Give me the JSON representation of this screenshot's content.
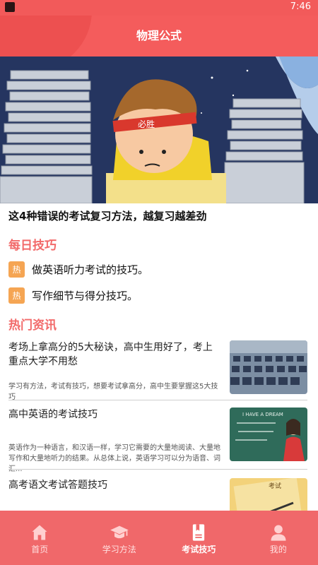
{
  "status_bar": {
    "time": "7:46"
  },
  "header": {
    "title": "物理公式"
  },
  "banner": {
    "caption": "这4种错误的考试复习方法，越复习越差劲",
    "headband_text": "必胜"
  },
  "daily_tips": {
    "title": "每日技巧",
    "items": [
      {
        "badge": "热",
        "text": "做英语听力考试的技巧。"
      },
      {
        "badge": "热",
        "text": "写作细节与得分技巧。"
      }
    ]
  },
  "hot_news": {
    "title": "热门资讯",
    "items": [
      {
        "headline": "考场上拿高分的5大秘诀，高中生用好了，考上重点大学不用愁",
        "summary": "学习有方法，考试有技巧，想要考试拿高分，高中生要掌握这5大技巧"
      },
      {
        "headline": "高中英语的考试技巧",
        "summary": "英语作为一种语言，和汉语一样，学习它需要的大量地阅读、大量地写作和大量地听力的结果。从总体上说，英语学习可以分为语音、词汇...",
        "thumb_text": "I HAVE A DREAM"
      },
      {
        "headline": "高考语文考试答题技巧",
        "summary": "",
        "thumb_text": "考试"
      }
    ]
  },
  "tab_bar": {
    "tabs": [
      {
        "label": "首页",
        "icon": "home-icon"
      },
      {
        "label": "学习方法",
        "icon": "graduation-cap-icon"
      },
      {
        "label": "考试技巧",
        "icon": "bookmark-document-icon",
        "active": true
      },
      {
        "label": "我的",
        "icon": "user-icon"
      }
    ]
  },
  "colors": {
    "primary": "#f45c5c",
    "accent_orange": "#f5a553",
    "section_title": "#f26a6a"
  }
}
